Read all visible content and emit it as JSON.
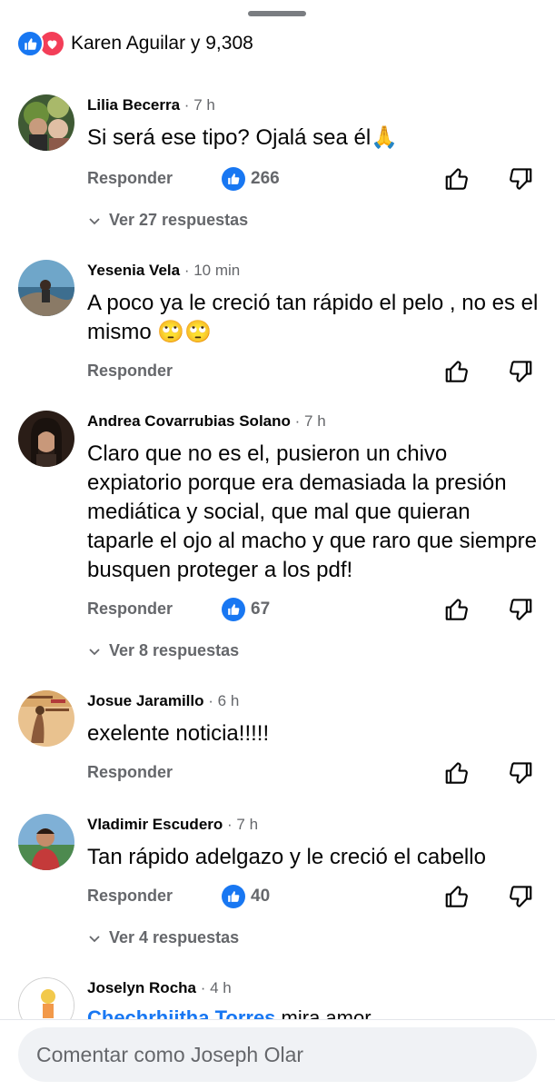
{
  "reactions_summary": {
    "text": "Karen Aguilar y 9,308",
    "icons": [
      "like-icon",
      "love-icon"
    ]
  },
  "comments": [
    {
      "author": "Lilia Becerra",
      "time": "7 h",
      "text": "Si será ese tipo? Ojalá sea él🙏",
      "reply_label": "Responder",
      "likes": "266",
      "replies_label": "Ver 27 respuestas"
    },
    {
      "author": "Yesenia Vela",
      "time": "10 min",
      "text": "A poco ya le creció tan rápido el pelo , no es el mismo 🙄🙄",
      "reply_label": "Responder"
    },
    {
      "author": "Andrea Covarrubias Solano",
      "time": "7 h",
      "text": "Claro que no es el, pusieron un chivo expiatorio porque era demasiada la presión mediática y social, que mal que quieran taparle el ojo al macho y que raro que siempre busquen proteger a los pdf!",
      "reply_label": "Responder",
      "likes": "67",
      "replies_label": "Ver 8 respuestas"
    },
    {
      "author": "Josue Jaramillo",
      "time": "6 h",
      "text": "exelente noticia!!!!!",
      "reply_label": "Responder"
    },
    {
      "author": "Vladimir Escudero",
      "time": "7 h",
      "text": "Tan rápido adelgazo y le creció el cabello",
      "reply_label": "Responder",
      "likes": "40",
      "replies_label": "Ver 4 respuestas"
    },
    {
      "author": "Joselyn Rocha",
      "time": "4 h",
      "mention": "Chechrhiitha Torres",
      "text_partial": "mira amor"
    }
  ],
  "meta_separator": "·",
  "composer": {
    "placeholder": "Comentar como Joseph Olar"
  },
  "colors": {
    "accent": "#1877f2",
    "love": "#f33e58",
    "secondary_text": "#65676b",
    "composer_bg": "#f0f2f5"
  }
}
